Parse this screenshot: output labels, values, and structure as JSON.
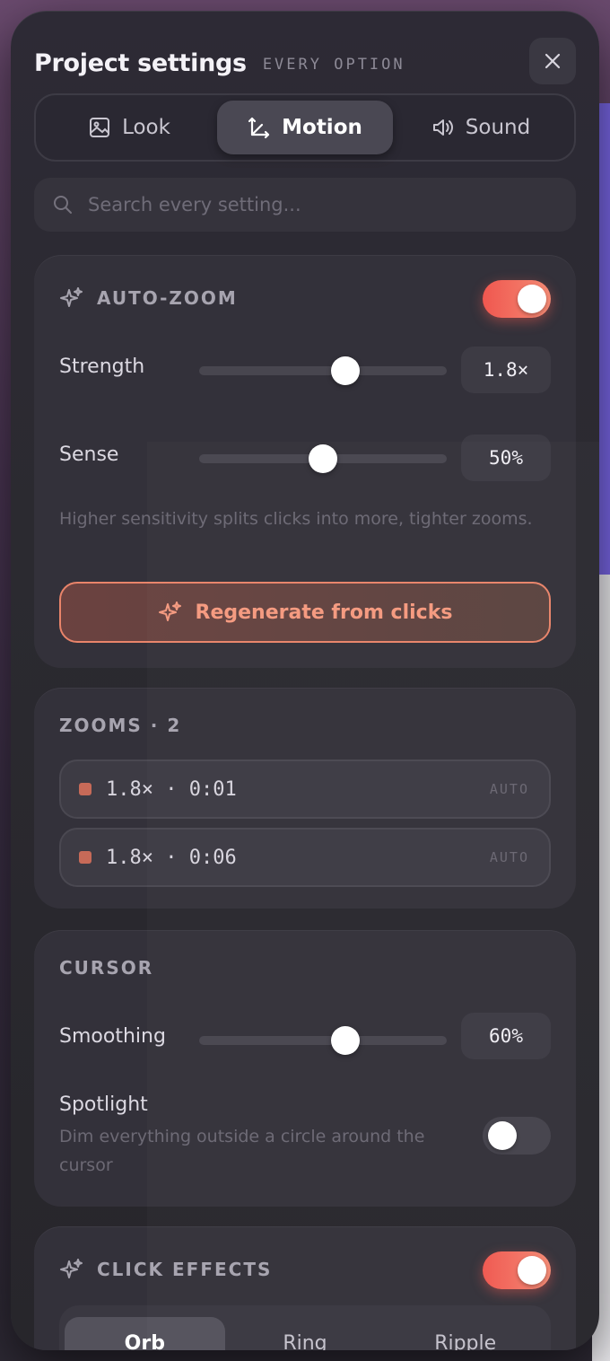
{
  "header": {
    "title": "Project settings",
    "subtitle": "EVERY OPTION"
  },
  "tabs": [
    {
      "label": "Look",
      "icon": "image-icon"
    },
    {
      "label": "Motion",
      "icon": "axis-arrows-icon",
      "active": true
    },
    {
      "label": "Sound",
      "icon": "speaker-icon"
    }
  ],
  "search": {
    "placeholder": "Search every setting..."
  },
  "auto_zoom": {
    "title": "AUTO-ZOOM",
    "enabled": true,
    "strength": {
      "label": "Strength",
      "value": "1.8×",
      "level": 0.59
    },
    "sense": {
      "label": "Sense",
      "value": "50%",
      "level": 0.5
    },
    "hint": "Higher sensitivity splits clicks into more, tighter zooms.",
    "regenerate_label": "Regenerate from clicks"
  },
  "zooms": {
    "title": "ZOOMS · 2",
    "items": [
      {
        "text": "1.8× · 0:01",
        "badge": "AUTO"
      },
      {
        "text": "1.8× · 0:06",
        "badge": "AUTO"
      }
    ]
  },
  "cursor": {
    "title": "CURSOR",
    "smoothing": {
      "label": "Smoothing",
      "value": "60%",
      "level": 0.59
    },
    "spotlight": {
      "label": "Spotlight",
      "description": "Dim everything outside a circle around the cursor",
      "enabled": false
    }
  },
  "click_effects": {
    "title": "CLICK EFFECTS",
    "enabled": true,
    "options": [
      "Orb",
      "Ring",
      "Ripple"
    ],
    "selected": "Orb"
  },
  "colors": {
    "accent": "#f0574f",
    "accent_light": "#f48a74",
    "panel": "#2b2a30",
    "card": "#33313a"
  }
}
